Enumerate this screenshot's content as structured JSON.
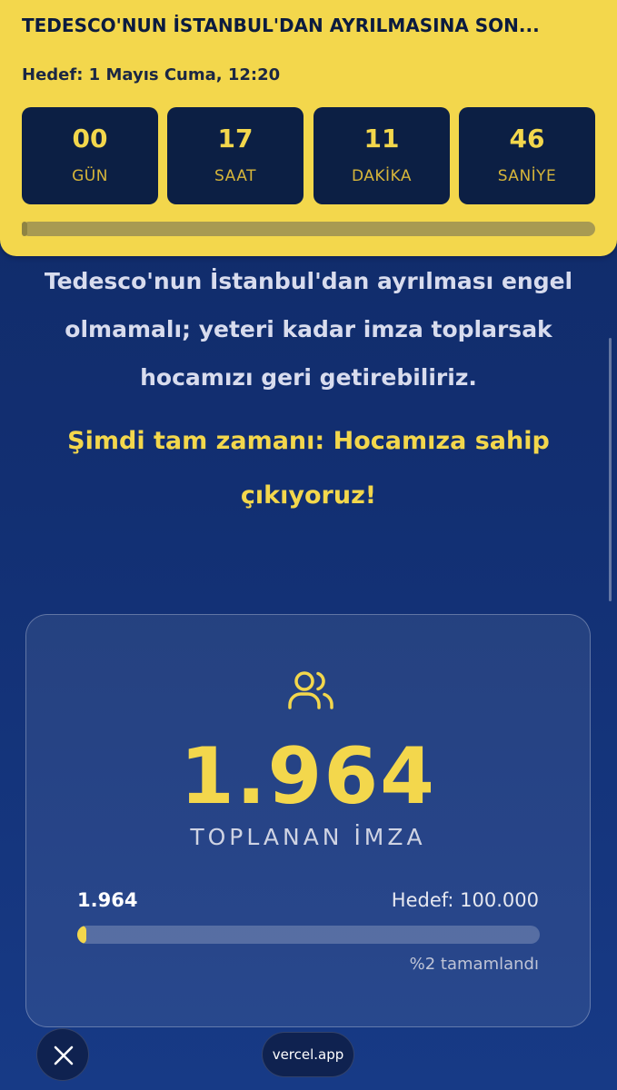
{
  "banner": {
    "title": "TEDESCO'NUN İSTANBUL'DAN AYRILMASINA SON...",
    "target": "Hedef: 1 Mayıs Cuma, 12:20",
    "countdown": [
      {
        "value": "00",
        "label": "GÜN"
      },
      {
        "value": "17",
        "label": "SAAT"
      },
      {
        "value": "11",
        "label": "DAKİKA"
      },
      {
        "value": "46",
        "label": "SANİYE"
      }
    ],
    "progress_percent": 1
  },
  "intro_text": "Tedesco'nun İstanbul'dan ayrılması engel olmamalı; yeteri kadar imza toplarsak hocamızı geri getirebiliriz.",
  "highlight_text": "Şimdi tam zamanı: Hocamıza sahip çıkıyoruz!",
  "signatures": {
    "icon": "users-icon",
    "count": "1.964",
    "label": "TOPLANAN İMZA",
    "current": "1.964",
    "goal": "Hedef: 100.000",
    "progress_percent": 2,
    "completed_text": "%2 tamamlandı"
  },
  "bottom": {
    "close_icon": "close-icon",
    "url": "vercel.app"
  },
  "colors": {
    "accent": "#f3d74c",
    "background": "#122f72",
    "box": "#0c1f44"
  }
}
